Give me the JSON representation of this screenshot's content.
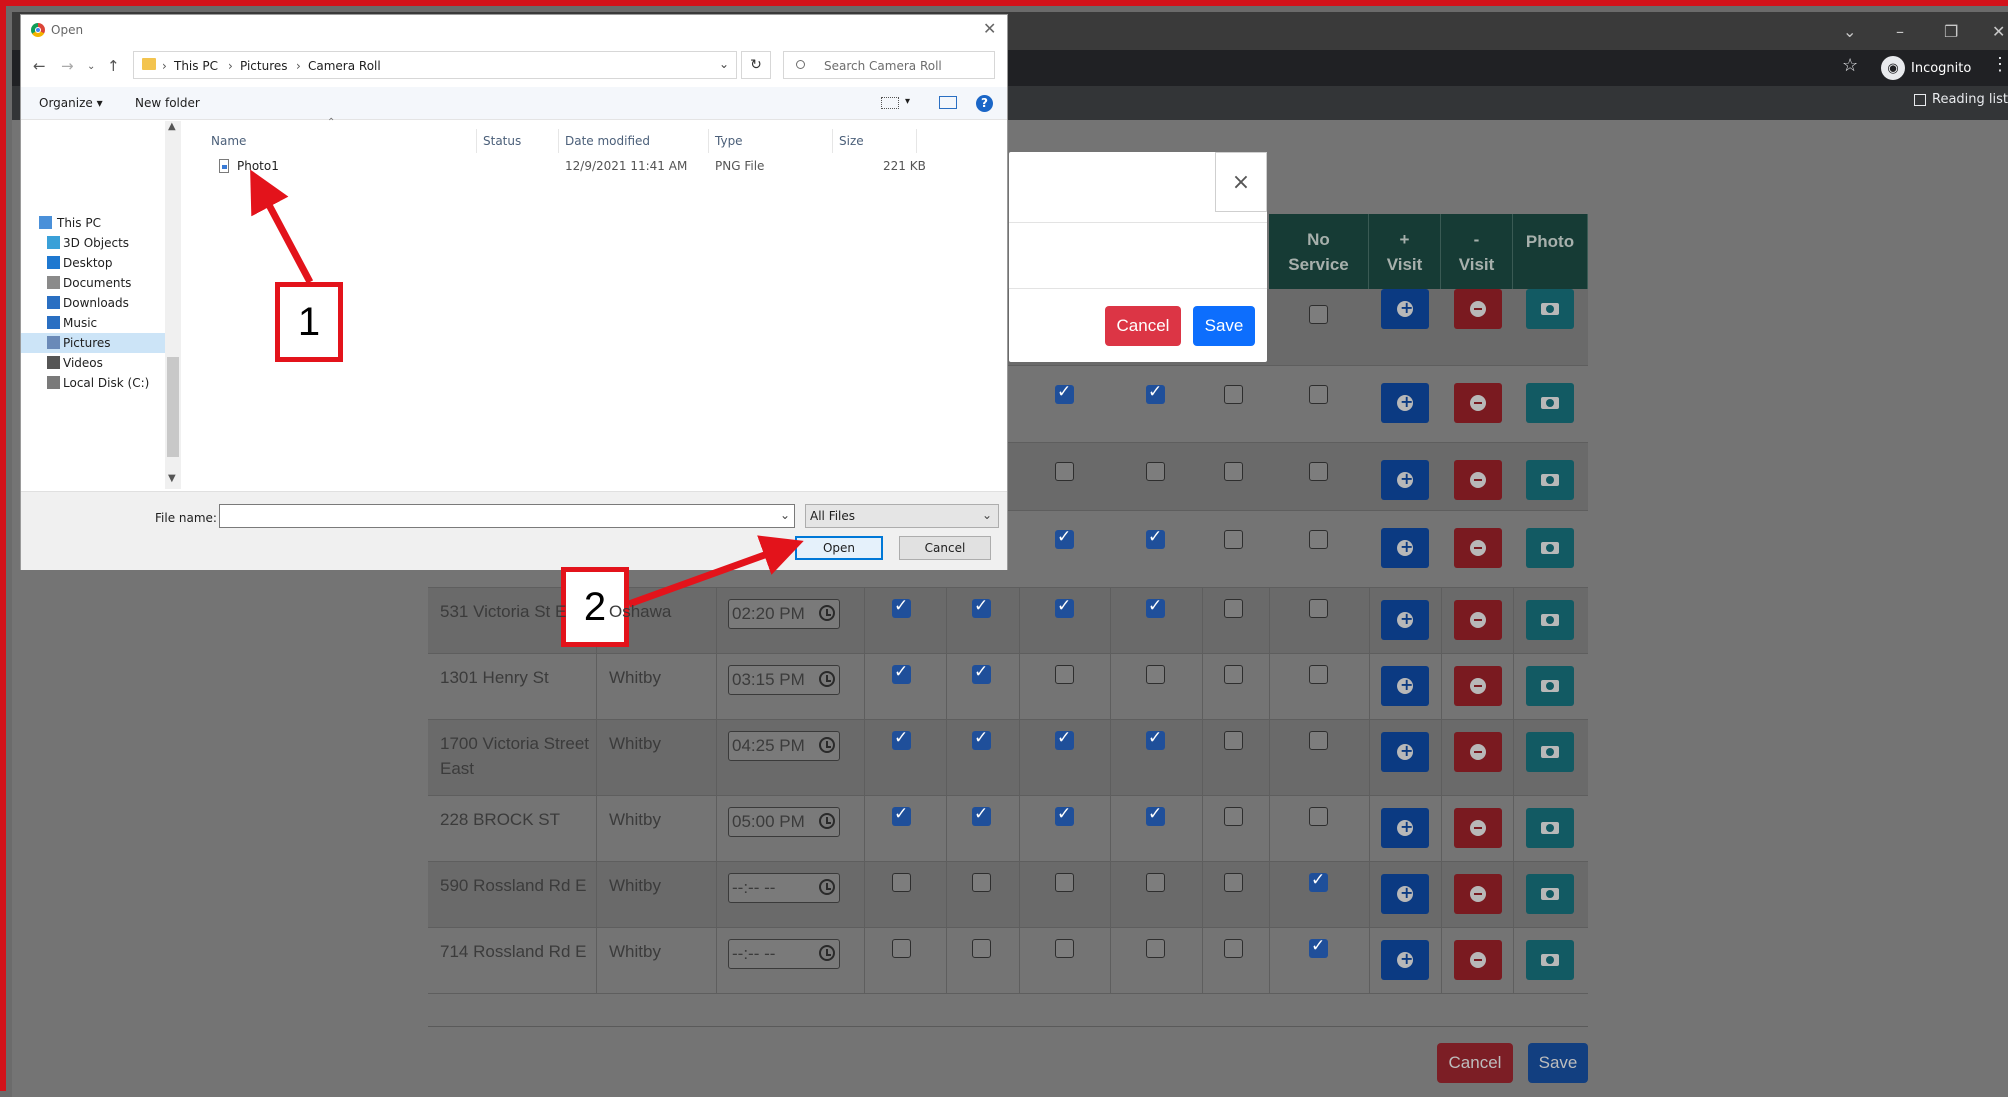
{
  "browser": {
    "incognito_label": "Incognito",
    "reading_list_label": "Reading list"
  },
  "table": {
    "headers": {
      "no_service": "No Service",
      "plus_visit": "+ Visit",
      "minus_visit": "- Visit",
      "photo": "Photo"
    },
    "rows": [
      {
        "address": "531 Victoria St E",
        "city": "Oshawa",
        "time": "02:20 PM",
        "checks": [
          true,
          true,
          true,
          true,
          false,
          false
        ]
      },
      {
        "address": "1301 Henry St",
        "city": "Whitby",
        "time": "03:15 PM",
        "checks": [
          true,
          true,
          false,
          false,
          false,
          false
        ]
      },
      {
        "address": "1700 Victoria Street East",
        "city": "Whitby",
        "time": "04:25 PM",
        "checks": [
          true,
          true,
          true,
          true,
          false,
          false
        ]
      },
      {
        "address": "228 BROCK ST",
        "city": "Whitby",
        "time": "05:00 PM",
        "checks": [
          true,
          true,
          true,
          true,
          false,
          false
        ]
      },
      {
        "address": "590 Rossland Rd E",
        "city": "Whitby",
        "time": "--:-- --",
        "checks": [
          false,
          false,
          false,
          false,
          false,
          true
        ]
      },
      {
        "address": "714 Rossland Rd E",
        "city": "Whitby",
        "time": "--:-- --",
        "checks": [
          false,
          false,
          false,
          false,
          false,
          true
        ]
      }
    ],
    "upper_rows": [
      {
        "checks": [
          false,
          false,
          false,
          false,
          false,
          false
        ],
        "show": [
          false,
          false,
          false,
          false,
          false,
          true
        ]
      },
      {
        "checks": [
          true,
          true,
          false,
          false
        ],
        "show": [
          false,
          false,
          true,
          true,
          true,
          true
        ]
      },
      {
        "checks": [
          false,
          false,
          false,
          false
        ],
        "show": [
          false,
          false,
          true,
          true,
          true,
          true
        ]
      },
      {
        "checks": [
          true,
          true,
          false,
          false
        ],
        "show": [
          false,
          false,
          true,
          true,
          true,
          true
        ]
      }
    ]
  },
  "page_buttons": {
    "cancel": "Cancel",
    "save": "Save"
  },
  "modal": {
    "close": "×",
    "cancel": "Cancel",
    "save": "Save"
  },
  "dialog": {
    "title": "Open",
    "breadcrumb": [
      "This PC",
      "Pictures",
      "Camera Roll"
    ],
    "search_placeholder": "Search Camera Roll",
    "toolbar": {
      "organize": "Organize ▾",
      "new_folder": "New folder"
    },
    "nav_items": [
      {
        "label": "This PC",
        "icon": "pc-icon"
      },
      {
        "label": "3D Objects",
        "icon": "cube-icon"
      },
      {
        "label": "Desktop",
        "icon": "desktop-icon"
      },
      {
        "label": "Documents",
        "icon": "documents-icon"
      },
      {
        "label": "Downloads",
        "icon": "download-icon"
      },
      {
        "label": "Music",
        "icon": "music-icon"
      },
      {
        "label": "Pictures",
        "icon": "pictures-icon",
        "selected": true
      },
      {
        "label": "Videos",
        "icon": "videos-icon"
      },
      {
        "label": "Local Disk (C:)",
        "icon": "disk-icon"
      }
    ],
    "columns": {
      "name": "Name",
      "status": "Status",
      "date": "Date modified",
      "type": "Type",
      "size": "Size"
    },
    "files": [
      {
        "name": "Photo1",
        "date": "12/9/2021 11:41 AM",
        "type": "PNG File",
        "size": "221 KB"
      }
    ],
    "file_name_label": "File name:",
    "file_name_value": "",
    "file_type": "All Files",
    "open": "Open",
    "cancel": "Cancel"
  },
  "annotations": {
    "step1": "1",
    "step2": "2"
  },
  "colors": {
    "frame": "#d3121a",
    "callout_border": "#e3131b",
    "primary_blue": "#0b3a82",
    "danger_red": "#7a1a20",
    "teal": "#125a63"
  }
}
